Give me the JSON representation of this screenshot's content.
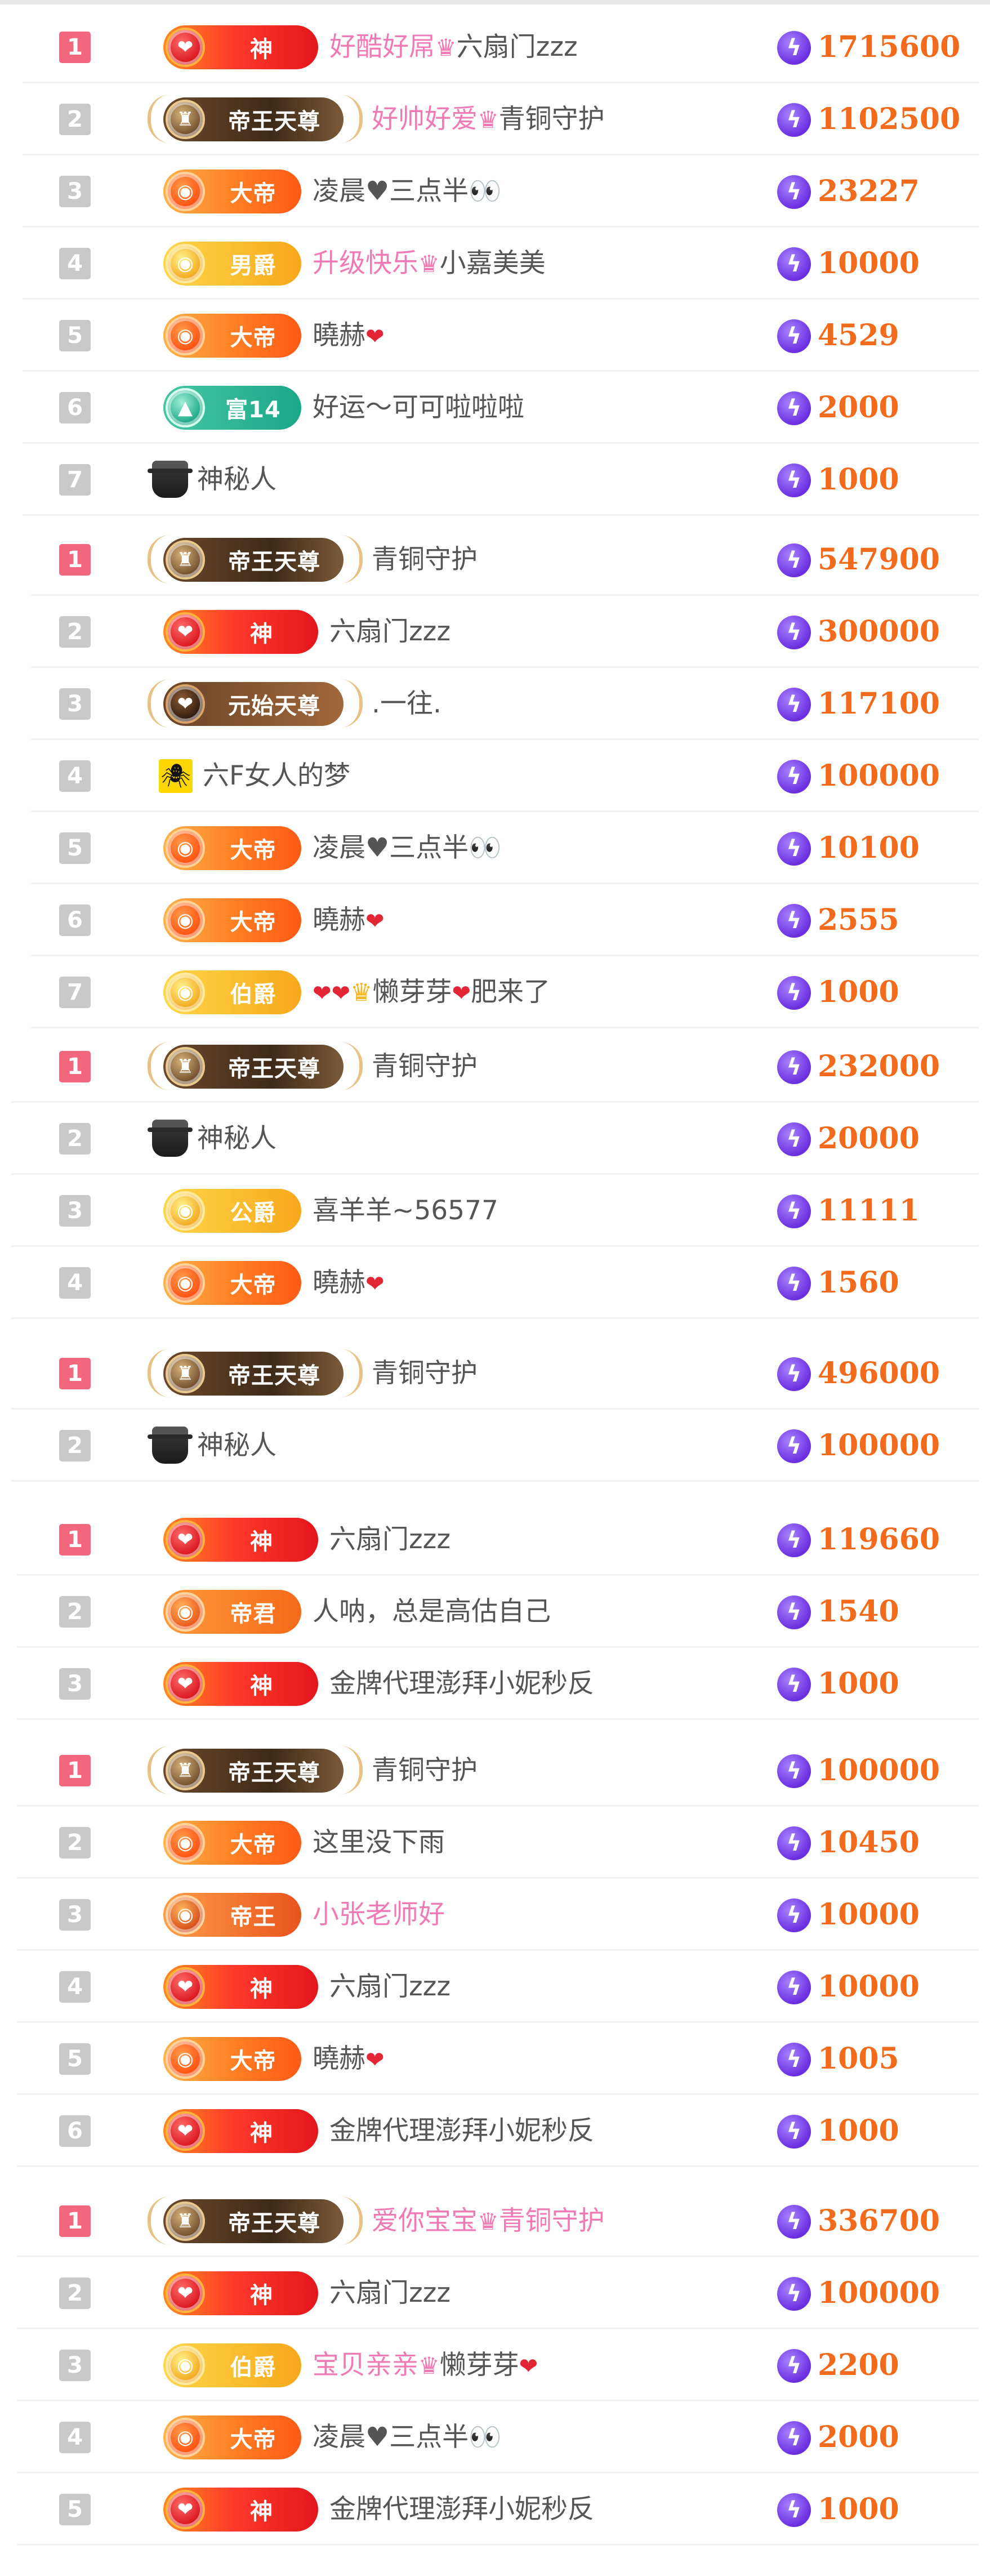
{
  "accent_colors": {
    "rank_top": "#f2667e",
    "rank_other": "#c9c9c9",
    "amount": "#f26a1b",
    "pink_name": "#f07ab4",
    "coin": "#6b2fe0"
  },
  "icons": {
    "coin": "lightning-coin-icon",
    "mystery": "mystery-man-icon",
    "crown": "crown-icon",
    "heart": "heart-icon"
  },
  "boards": [
    {
      "x": 20,
      "rows": [
        {
          "rank": "1",
          "badge": "shen",
          "badge_label": "神",
          "name_parts": [
            {
              "t": "好酷好屌",
              "pink": true
            },
            {
              "crown": true
            },
            {
              "t": "六扇门zzz"
            }
          ],
          "amount": "1715600"
        },
        {
          "rank": "2",
          "badge": "dawang",
          "badge_label": "帝王天尊",
          "name_parts": [
            {
              "t": "好帅好爱",
              "pink": true
            },
            {
              "crown": true
            },
            {
              "t": "青铜守护"
            }
          ],
          "amount": "1102500"
        },
        {
          "rank": "3",
          "badge": "dadi",
          "badge_label": "大帝",
          "name_parts": [
            {
              "t": "凌晨♥三点半👀"
            }
          ],
          "amount": "23227"
        },
        {
          "rank": "4",
          "badge": "nanjue",
          "badge_label": "男爵",
          "name_parts": [
            {
              "t": "升级快乐",
              "pink": true
            },
            {
              "crown": true
            },
            {
              "t": "小嘉美美"
            }
          ],
          "amount": "10000"
        },
        {
          "rank": "5",
          "badge": "dadi",
          "badge_label": "大帝",
          "name_parts": [
            {
              "t": "曉赫"
            },
            {
              "heart": true
            }
          ],
          "amount": "4529"
        },
        {
          "rank": "6",
          "badge": "fu",
          "badge_label": "富14",
          "name_parts": [
            {
              "t": "好运～可可啦啦啦"
            }
          ],
          "amount": "2000"
        },
        {
          "rank": "7",
          "badge": "mystery",
          "badge_label": "",
          "name_parts": [
            {
              "t": "神秘人"
            }
          ],
          "amount": "1000"
        }
      ]
    },
    {
      "x": 35,
      "rows": [
        {
          "rank": "1",
          "badge": "dawang",
          "badge_label": "帝王天尊",
          "name_parts": [
            {
              "t": "青铜守护"
            }
          ],
          "amount": "547900"
        },
        {
          "rank": "2",
          "badge": "shen",
          "badge_label": "神",
          "name_parts": [
            {
              "t": "六扇门zzz"
            }
          ],
          "amount": "300000"
        },
        {
          "rank": "3",
          "badge": "yuanshi",
          "badge_label": "元始天尊",
          "name_parts": [
            {
              "t": ".一往."
            }
          ],
          "amount": "117100"
        },
        {
          "rank": "4",
          "badge": "square",
          "badge_label": "",
          "name_parts": [
            {
              "t": "六F女人的梦"
            }
          ],
          "amount": "100000"
        },
        {
          "rank": "5",
          "badge": "dadi",
          "badge_label": "大帝",
          "name_parts": [
            {
              "t": "凌晨♥三点半👀"
            }
          ],
          "amount": "10100"
        },
        {
          "rank": "6",
          "badge": "dadi",
          "badge_label": "大帝",
          "name_parts": [
            {
              "t": "曉赫"
            },
            {
              "heart": true
            }
          ],
          "amount": "2555"
        },
        {
          "rank": "7",
          "badge": "nanjue",
          "badge_label": "伯爵",
          "name_parts": [
            {
              "heart": true
            },
            {
              "heart": true
            },
            {
              "gcrown": true
            },
            {
              "t": "懒芽芽"
            },
            {
              "heart": true
            },
            {
              "t": "肥来了"
            }
          ],
          "amount": "1000"
        }
      ]
    },
    {
      "x": 0,
      "rows": [
        {
          "rank": "1",
          "badge": "dawang",
          "badge_label": "帝王天尊",
          "name_parts": [
            {
              "t": "青铜守护"
            }
          ],
          "amount": "232000"
        },
        {
          "rank": "2",
          "badge": "mystery",
          "badge_label": "",
          "name_parts": [
            {
              "t": "神秘人"
            }
          ],
          "amount": "20000"
        },
        {
          "rank": "3",
          "badge": "nanjue",
          "badge_label": "公爵",
          "name_parts": [
            {
              "t": "喜羊羊~56577"
            }
          ],
          "amount": "11111"
        },
        {
          "rank": "4",
          "badge": "dadi",
          "badge_label": "大帝",
          "name_parts": [
            {
              "t": "曉赫"
            },
            {
              "heart": true
            }
          ],
          "amount": "1560"
        }
      ]
    },
    {
      "x": 0,
      "rows": [
        {
          "rank": "1",
          "badge": "dawang",
          "badge_label": "帝王天尊",
          "name_parts": [
            {
              "t": "青铜守护"
            }
          ],
          "amount": "496000"
        },
        {
          "rank": "2",
          "badge": "mystery",
          "badge_label": "",
          "name_parts": [
            {
              "t": "神秘人"
            }
          ],
          "amount": "100000"
        }
      ]
    },
    {
      "x": 10,
      "rows": [
        {
          "rank": "1",
          "badge": "shen",
          "badge_label": "神",
          "name_parts": [
            {
              "t": "六扇门zzz"
            }
          ],
          "amount": "119660"
        },
        {
          "rank": "2",
          "badge": "dijun",
          "badge_label": "帝君",
          "name_parts": [
            {
              "t": "人呐，总是高估自己"
            }
          ],
          "amount": "1540"
        },
        {
          "rank": "3",
          "badge": "shen",
          "badge_label": "神",
          "name_parts": [
            {
              "t": "金牌代理澎拜小妮秒反"
            }
          ],
          "amount": "1000"
        }
      ]
    },
    {
      "x": 10,
      "rows": [
        {
          "rank": "1",
          "badge": "dawang",
          "badge_label": "帝王天尊",
          "name_parts": [
            {
              "t": "青铜守护"
            }
          ],
          "amount": "100000"
        },
        {
          "rank": "2",
          "badge": "dadi",
          "badge_label": "大帝",
          "name_parts": [
            {
              "t": "这里没下雨"
            }
          ],
          "amount": "10450"
        },
        {
          "rank": "3",
          "badge": "diwang",
          "badge_label": "帝王",
          "name_parts": [
            {
              "t": "小张老师好",
              "pink": true
            }
          ],
          "amount": "10000"
        },
        {
          "rank": "4",
          "badge": "shen",
          "badge_label": "神",
          "name_parts": [
            {
              "t": "六扇门zzz"
            }
          ],
          "amount": "10000"
        },
        {
          "rank": "5",
          "badge": "dadi",
          "badge_label": "大帝",
          "name_parts": [
            {
              "t": "曉赫"
            },
            {
              "heart": true
            }
          ],
          "amount": "1005"
        },
        {
          "rank": "6",
          "badge": "shen",
          "badge_label": "神",
          "name_parts": [
            {
              "t": "金牌代理澎拜小妮秒反"
            }
          ],
          "amount": "1000"
        }
      ]
    },
    {
      "x": 10,
      "rows": [
        {
          "rank": "1",
          "badge": "dawang",
          "badge_label": "帝王天尊",
          "name_parts": [
            {
              "t": "爱你宝宝",
              "pink": true
            },
            {
              "crown": true
            },
            {
              "t": "青铜守护",
              "pink": true
            }
          ],
          "amount": "336700"
        },
        {
          "rank": "2",
          "badge": "shen",
          "badge_label": "神",
          "name_parts": [
            {
              "t": "六扇门zzz"
            }
          ],
          "amount": "100000"
        },
        {
          "rank": "3",
          "badge": "nanjue",
          "badge_label": "伯爵",
          "name_parts": [
            {
              "t": "宝贝亲亲",
              "pink": true
            },
            {
              "crown": true
            },
            {
              "t": "懒芽芽"
            },
            {
              "heart": true
            }
          ],
          "amount": "2200"
        },
        {
          "rank": "4",
          "badge": "dadi",
          "badge_label": "大帝",
          "name_parts": [
            {
              "t": "凌晨♥三点半👀"
            }
          ],
          "amount": "2000"
        },
        {
          "rank": "5",
          "badge": "shen",
          "badge_label": "神",
          "name_parts": [
            {
              "t": "金牌代理澎拜小妮秒反"
            }
          ],
          "amount": "1000"
        }
      ]
    }
  ]
}
